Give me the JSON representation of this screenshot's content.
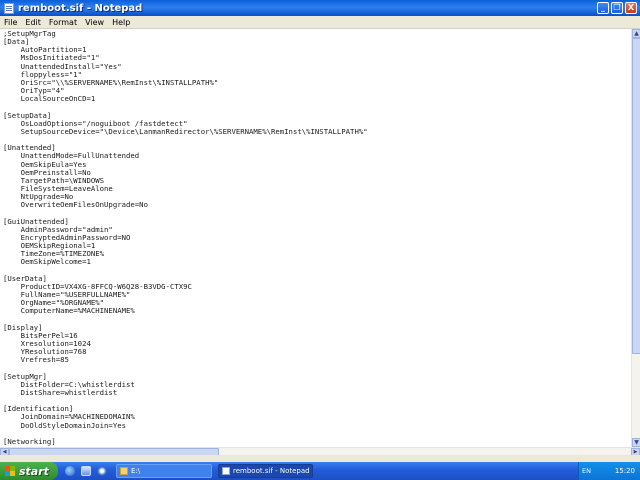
{
  "window": {
    "title": "remboot.sif - Notepad",
    "minimize_glyph": "_",
    "restore_glyph": "❐",
    "close_glyph": "X"
  },
  "menu": [
    "File",
    "Edit",
    "Format",
    "View",
    "Help"
  ],
  "document": {
    "content": ";SetupMgrTag\n[Data]\n    AutoPartition=1\n    MsDosInitiated=\"1\"\n    UnattendedInstall=\"Yes\"\n    floppyless=\"1\"\n    OriSrc=\"\\\\%SERVERNAME%\\RemInst\\%INSTALLPATH%\"\n    OriTyp=\"4\"\n    LocalSourceOnCD=1\n\n[SetupData]\n    OsLoadOptions=\"/noguiboot /fastdetect\"\n    SetupSourceDevice=\"\\Device\\LanmanRedirector\\%SERVERNAME%\\RemInst\\%INSTALLPATH%\"\n\n[Unattended]\n    UnattendMode=FullUnattended\n    OemSkipEula=Yes\n    OemPreinstall=No\n    TargetPath=\\WINDOWS\n    FileSystem=LeaveAlone\n    NtUpgrade=No\n    OverwriteOemFilesOnUpgrade=No\n\n[GuiUnattended]\n    AdminPassword=\"admin\"\n    EncryptedAdminPassword=NO\n    OEMSkipRegional=1\n    TimeZone=%TIMEZONE%\n    OemSkipWelcome=1\n\n[UserData]\n    ProductID=VX4XG-8FFCQ-W6Q28-B3VDG-CTX9C\n    FullName=\"%USERFULLNAME%\"\n    OrgName=\"%ORGNAME%\"\n    ComputerName=%MACHINENAME%\n\n[Display]\n    BitsPerPel=16\n    Xresolution=1024\n    YResolution=768\n    Vrefresh=85\n\n[SetupMgr]\n    DistFolder=C:\\whistlerdist\n    DistShare=whistlerdist\n\n[Identification]\n    JoinDomain=%MACHINEDOMAIN%\n    DoOldStyleDomainJoin=Yes\n\n[Networking]"
  },
  "taskbar": {
    "start_label": "start",
    "tasks": [
      {
        "label": "E:\\",
        "icon": "folder-icon",
        "active": false
      },
      {
        "label": "remboot.sif - Notepad",
        "icon": "notepad-icon",
        "active": true
      }
    ],
    "language": "EN",
    "clock": "15:20"
  },
  "colors": {
    "titlebar": "#0a5fd8",
    "taskbar": "#245edb",
    "start": "#3a9a3a",
    "tray": "#0d80e0"
  }
}
